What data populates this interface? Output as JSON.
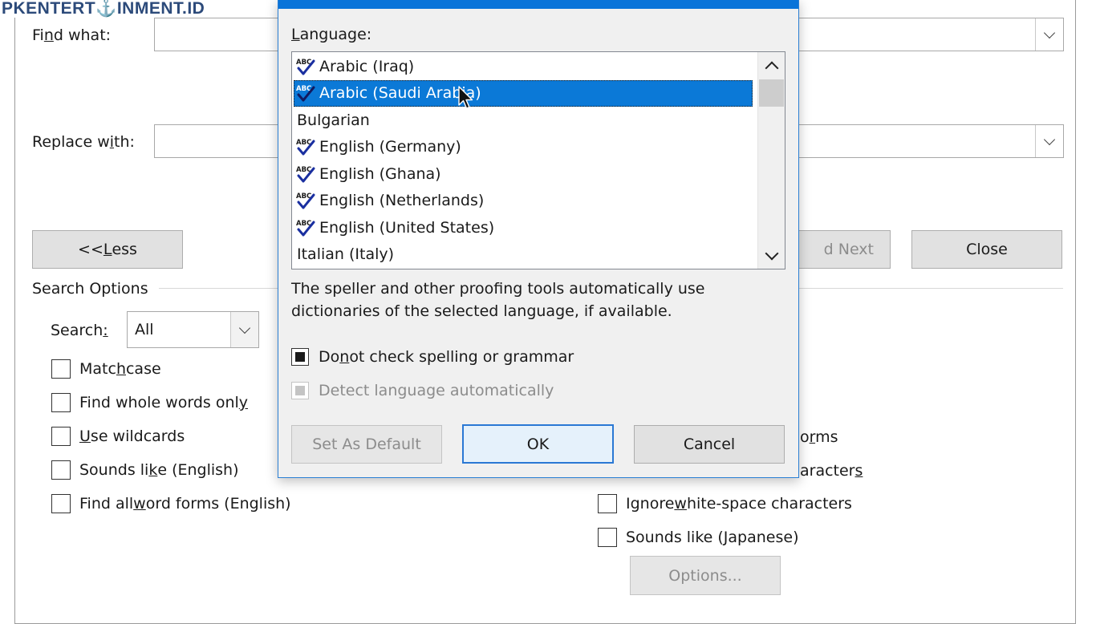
{
  "watermark": "PKENTERT⚓INMENT.ID",
  "find_replace": {
    "find_label_pre": "Fi",
    "find_label_u": "n",
    "find_label_post": "d what:",
    "replace_label_pre": "Replace w",
    "replace_label_u": "i",
    "replace_label_post": "th:",
    "find_value": "",
    "replace_value": "",
    "less_button_pre": "<< ",
    "less_button_u": "L",
    "less_button_post": "ess",
    "find_next_partial": "d Next",
    "close_button": "Close",
    "search_options_label": "Search Options",
    "search_label_pre": "Search",
    "search_label_u": ":",
    "search_value": "All",
    "checkboxes_left": [
      {
        "pre": "Matc",
        "u": "h",
        "post": " case",
        "checked": false
      },
      {
        "pre": "Find whole words onl",
        "u": "y",
        "post": "",
        "checked": false
      },
      {
        "pre": "",
        "u": "U",
        "post": "se wildcards",
        "checked": false
      },
      {
        "pre": "Sounds li",
        "u": "k",
        "post": "e (English)",
        "checked": false
      },
      {
        "pre": "Find all ",
        "u": "w",
        "post": "ord forms (English)",
        "checked": false
      }
    ],
    "checkboxes_right_partial": [
      {
        "pre": "o",
        "u": "r",
        "post": "ms"
      },
      {
        "pre": "aracter",
        "u": "s",
        "post": ""
      }
    ],
    "checkboxes_right": [
      {
        "pre": "Ignore ",
        "u": "w",
        "post": "hite-space characters",
        "checked": false
      },
      {
        "pre": "Sounds like (",
        "u": "J",
        "post": "apanese)",
        "checked": false
      }
    ],
    "options_button": "Options..."
  },
  "language_dialog": {
    "language_label_u": "L",
    "language_label_post": "anguage:",
    "items": [
      {
        "label": "Arabic (Iraq)",
        "spell_icon": true,
        "selected": false
      },
      {
        "label": "Arabic (Saudi Arabia)",
        "spell_icon": true,
        "selected": true
      },
      {
        "label": "Bulgarian",
        "spell_icon": false,
        "selected": false
      },
      {
        "label": "English (Germany)",
        "spell_icon": true,
        "selected": false
      },
      {
        "label": "English (Ghana)",
        "spell_icon": true,
        "selected": false
      },
      {
        "label": "English (Netherlands)",
        "spell_icon": true,
        "selected": false
      },
      {
        "label": "English (United States)",
        "spell_icon": true,
        "selected": false
      },
      {
        "label": "Italian (Italy)",
        "spell_icon": false,
        "selected": false
      }
    ],
    "description_line1": "The speller and other proofing tools automatically use",
    "description_line2": "dictionaries of the selected language, if available.",
    "no_check_pre": "Do ",
    "no_check_u": "n",
    "no_check_post": "ot check spelling or grammar",
    "no_check_state": "indeterminate",
    "detect_label": "Detect language automatically",
    "detect_state": "indeterminate-disabled",
    "set_default_button": "Set As Default",
    "ok_button": "OK",
    "cancel_button": "Cancel"
  },
  "colors": {
    "selection": "#0b79d7",
    "titlebar": "#0a74d9",
    "dialog_bg": "#f0f0f0"
  }
}
